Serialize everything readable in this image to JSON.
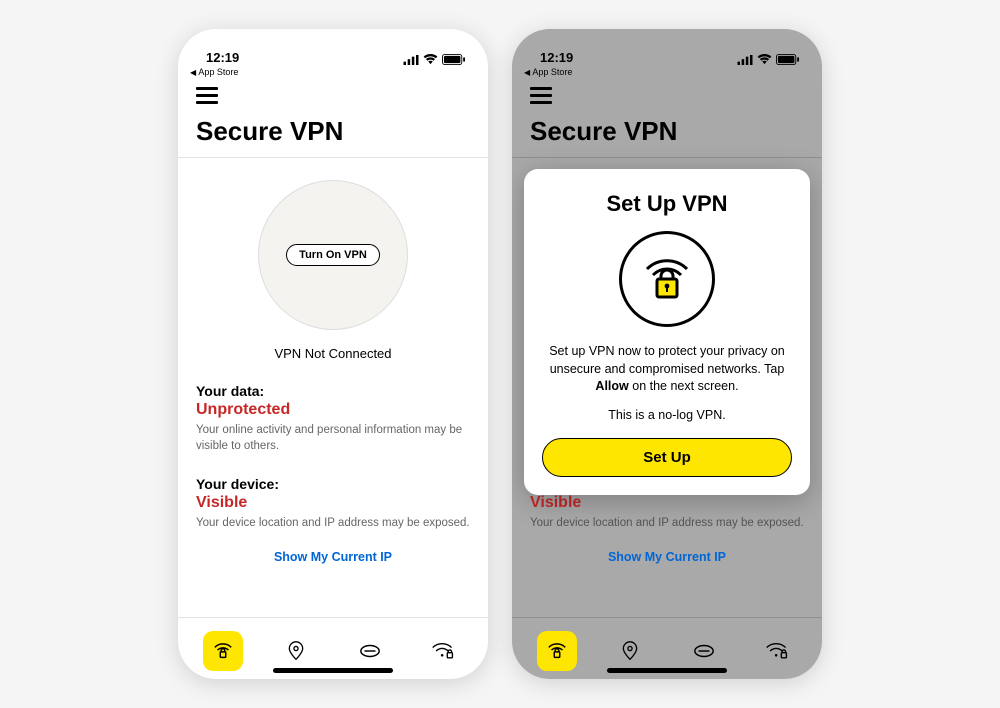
{
  "status": {
    "time": "12:19",
    "back_app": "App Store"
  },
  "header": {
    "title": "Secure VPN"
  },
  "vpn": {
    "button_label": "Turn On VPN",
    "status_text": "VPN Not Connected"
  },
  "data_section": {
    "label": "Your data:",
    "value": "Unprotected",
    "desc": "Your online activity and personal information may be visible to others."
  },
  "device_section": {
    "label": "Your device:",
    "value": "Visible",
    "desc": "Your device location and IP address may be exposed."
  },
  "show_ip_label": "Show My Current IP",
  "modal": {
    "title": "Set Up VPN",
    "desc_pre": "Set up VPN now to protect your privacy on unsecure and compromised networks. Tap ",
    "desc_bold": "Allow",
    "desc_post": " on the next screen.",
    "note": "This is a no-log VPN.",
    "button": "Set Up"
  },
  "colors": {
    "danger": "#c62828",
    "accent": "#ffe600",
    "link": "#0066d6"
  }
}
